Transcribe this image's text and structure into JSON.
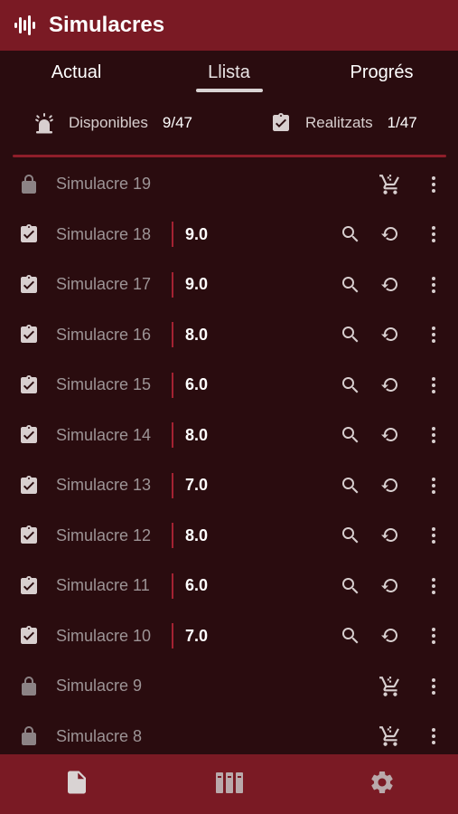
{
  "appbar": {
    "title": "Simulacres",
    "logo_icon": "waveform-icon"
  },
  "tabs": [
    {
      "label": "Actual",
      "active": false
    },
    {
      "label": "Llista",
      "active": true
    },
    {
      "label": "Progrés",
      "active": false
    }
  ],
  "stats": {
    "available": {
      "label": "Disponibles",
      "value": "9/47",
      "icon": "alarm-light-icon"
    },
    "done": {
      "label": "Realitzats",
      "value": "1/47",
      "icon": "clipboard-check-icon"
    }
  },
  "colors": {
    "background": "#2a0c0f",
    "bar": "#7a1a24",
    "accent": "#a42232"
  },
  "items": [
    {
      "name": "Simulacre 19",
      "state": "locked",
      "score": ""
    },
    {
      "name": "Simulacre 18",
      "state": "done",
      "score": "9.0"
    },
    {
      "name": "Simulacre 17",
      "state": "done",
      "score": "9.0"
    },
    {
      "name": "Simulacre 16",
      "state": "done",
      "score": "8.0"
    },
    {
      "name": "Simulacre 15",
      "state": "done",
      "score": "6.0"
    },
    {
      "name": "Simulacre 14",
      "state": "done",
      "score": "8.0"
    },
    {
      "name": "Simulacre 13",
      "state": "done",
      "score": "7.0"
    },
    {
      "name": "Simulacre 12",
      "state": "done",
      "score": "8.0"
    },
    {
      "name": "Simulacre 11",
      "state": "done",
      "score": "6.0"
    },
    {
      "name": "Simulacre 10",
      "state": "done",
      "score": "7.0"
    },
    {
      "name": "Simulacre 9",
      "state": "locked",
      "score": ""
    },
    {
      "name": "Simulacre 8",
      "state": "locked",
      "score": ""
    }
  ],
  "bottom_nav": [
    {
      "name": "document-icon",
      "active": true
    },
    {
      "name": "library-icon",
      "active": false
    },
    {
      "name": "settings-icon",
      "active": false
    }
  ]
}
